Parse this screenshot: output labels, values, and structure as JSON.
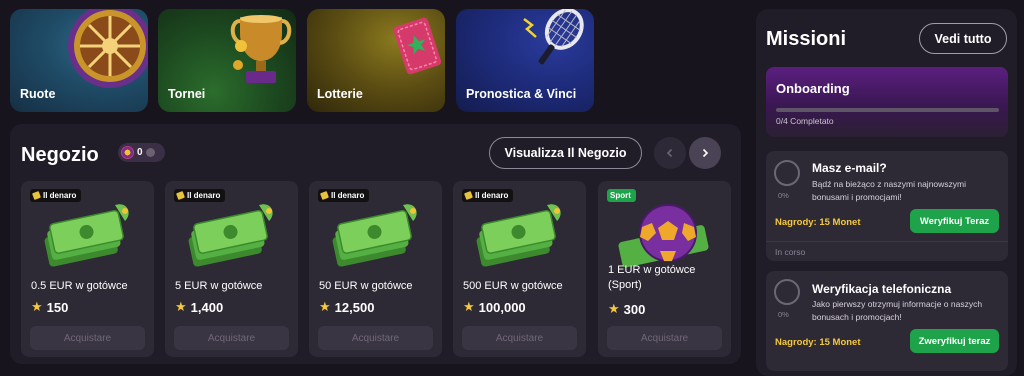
{
  "categories": [
    {
      "label": "Ruote",
      "icon": "wheel-icon"
    },
    {
      "label": "Tornei",
      "icon": "trophy-icon"
    },
    {
      "label": "Lotterie",
      "icon": "ticket-icon"
    },
    {
      "label": "Pronostica & Vinci",
      "icon": "tennis-racket-icon"
    }
  ],
  "shop": {
    "title": "Negozio",
    "coins": "0",
    "view_label": "Visualizza Il Negozio",
    "items": [
      {
        "badge": "Il denaro",
        "title": "0.5 EUR w gotówce",
        "price": "150",
        "buy": "Acquistare"
      },
      {
        "badge": "Il denaro",
        "title": "5 EUR w gotówce",
        "price": "1,400",
        "buy": "Acquistare"
      },
      {
        "badge": "Il denaro",
        "title": "50 EUR w gotówce",
        "price": "12,500",
        "buy": "Acquistare"
      },
      {
        "badge": "Il denaro",
        "title": "500 EUR w gotówce",
        "price": "100,000",
        "buy": "Acquistare"
      },
      {
        "badge": "Sport",
        "title": "1 EUR w gotówce (Sport)",
        "price": "300",
        "buy": "Acquistare"
      }
    ]
  },
  "missions": {
    "title": "Missioni",
    "see_all": "Vedi tutto",
    "onboarding": {
      "name": "Onboarding",
      "progress_text": "0/4 Completato",
      "progress": 0
    },
    "items": [
      {
        "name": "Masz e-mail?",
        "desc": "Bądź na bieżąco z naszymi najnowszymi bonusami i promocjami!",
        "reward": "Nagrody: 15 Monet",
        "action": "Weryfikuj Teraz",
        "percent": "0%",
        "status": "In corso"
      },
      {
        "name": "Weryfikacja telefoniczna",
        "desc": "Jako pierwszy otrzymuj informacje o naszych bonusach i promocjach!",
        "reward": "Nagrody: 15 Monet",
        "action": "Zweryfikuj teraz",
        "percent": "0%"
      }
    ]
  },
  "colors": {
    "accent_green": "#1ea34a",
    "gold": "#f5c93d",
    "purple": "#5b1f80",
    "panel": "#211d28"
  }
}
